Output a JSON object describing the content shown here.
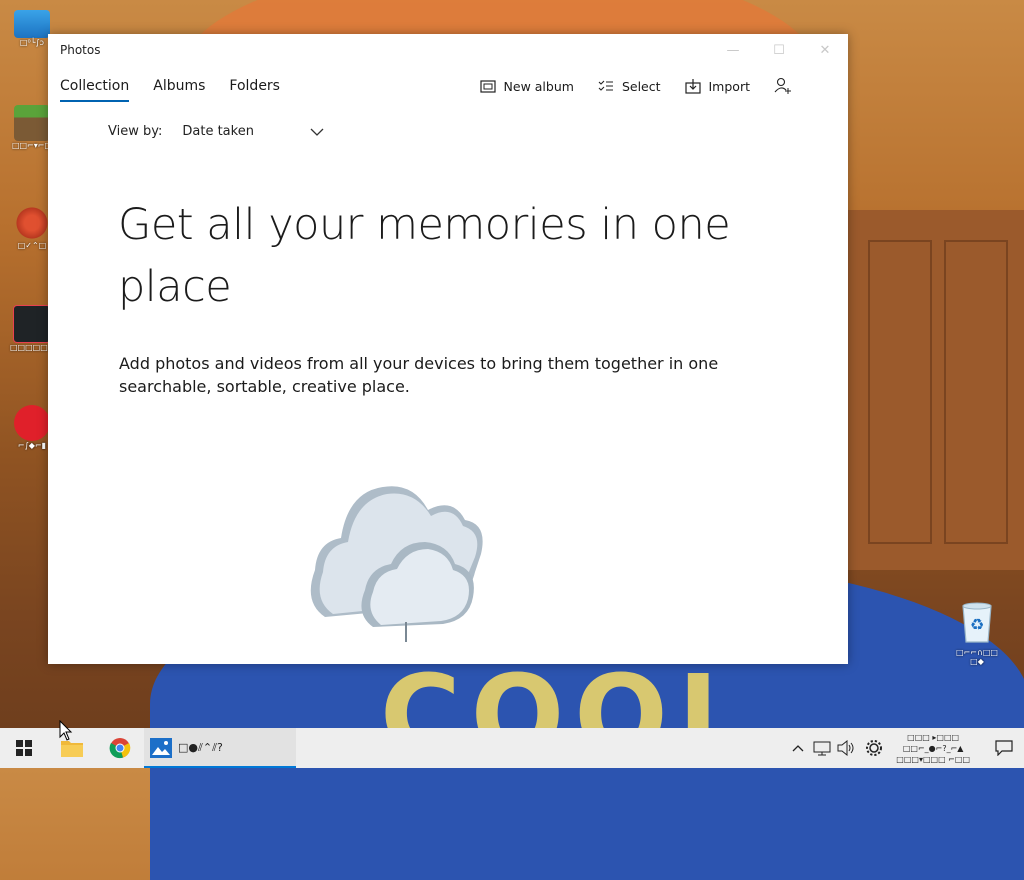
{
  "desktop": {
    "icons": [
      {
        "icon": "monitor-icon",
        "label": "□⁰└∫ↄ"
      },
      {
        "icon": "minecraft-icon",
        "label": "□□⌐▾⌐□"
      },
      {
        "icon": "app-icon-red",
        "label": "□✓⌃□"
      },
      {
        "icon": "valorant-icon",
        "label": "□□□□□□"
      },
      {
        "icon": "riot-icon",
        "label": "⌐∫◆⌐▮"
      }
    ],
    "recycle_bin": {
      "icon": "recycle-bin-icon",
      "label": "□⌐⌐∩□□ □◆"
    }
  },
  "window": {
    "title": "Photos",
    "controls": {
      "minimize": "—",
      "maximize": "☐",
      "close": "✕"
    },
    "tabs": [
      {
        "label": "Collection",
        "active": true
      },
      {
        "label": "Albums",
        "active": false
      },
      {
        "label": "Folders",
        "active": false
      }
    ],
    "actions": {
      "new_album": "New album",
      "select": "Select",
      "import": "Import"
    },
    "view_by": {
      "label": "View by:",
      "value": "Date taken"
    },
    "headline": "Get all your memories in one place",
    "description": "Add photos and videos from all your devices to bring them together in one searchable, sortable, creative place."
  },
  "taskbar": {
    "photos_label": "□●⫽⌃⫽?",
    "clock": {
      "line1": "□□□ ▸□□□",
      "line2": "□□⌐_●⌐?_⌐▲",
      "line3": "□□□▾□□□ ⌐□□"
    },
    "accent": "#0078d7"
  },
  "colors": {
    "accent": "#0063b1",
    "window_bg": "#ffffff",
    "taskbar_bg": "#eeeeee"
  }
}
